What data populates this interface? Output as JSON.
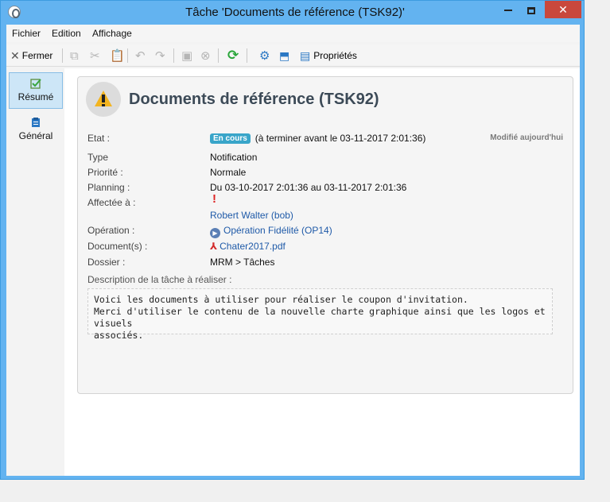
{
  "window": {
    "title": "Tâche 'Documents de référence (TSK92)'",
    "close_glyph": "✕"
  },
  "menu": {
    "items": [
      "Fichier",
      "Edition",
      "Affichage"
    ]
  },
  "toolbar": {
    "close_label": "Fermer",
    "properties_label": "Propriétés"
  },
  "nav": {
    "items": [
      {
        "label": "Résumé",
        "icon": "checkmark-icon"
      },
      {
        "label": "Général",
        "icon": "clipboard-icon"
      }
    ]
  },
  "task": {
    "title": "Documents de référence (TSK92)",
    "modified": "Modifié aujourd'hui",
    "fields": {
      "etat_label": "Etat :",
      "etat_badge": "En cours",
      "etat_value": "(à terminer avant le 03-11-2017 2:01:36)",
      "type_label": "Type",
      "type_value": "Notification",
      "priorite_label": "Priorité :",
      "priorite_value": "Normale",
      "planning_label": "Planning :",
      "planning_value": "Du 03-10-2017 2:01:36 au 03-11-2017 2:01:36",
      "affectee_label": "Affectée à :",
      "affectee_value": "Robert Walter (bob)",
      "operation_label": "Opération :",
      "operation_value": "Opération Fidélité (OP14)",
      "documents_label": "Document(s) :",
      "documents_value": "Chater2017.pdf",
      "dossier_label": "Dossier :",
      "dossier_value": "MRM > Tâches"
    },
    "description_label": "Description de la tâche à réaliser :",
    "description": "Voici les documents à utiliser pour réaliser le coupon d'invitation.\nMerci d'utiliser le contenu de la nouvelle charte graphique ainsi que les logos et visuels\nassociés."
  },
  "colors": {
    "titlebar": "#63b3f0",
    "close_button": "#c9483c",
    "accent_link": "#1f5aa8",
    "status_badge": "#39a5c9",
    "warning": "#f3b41f"
  }
}
